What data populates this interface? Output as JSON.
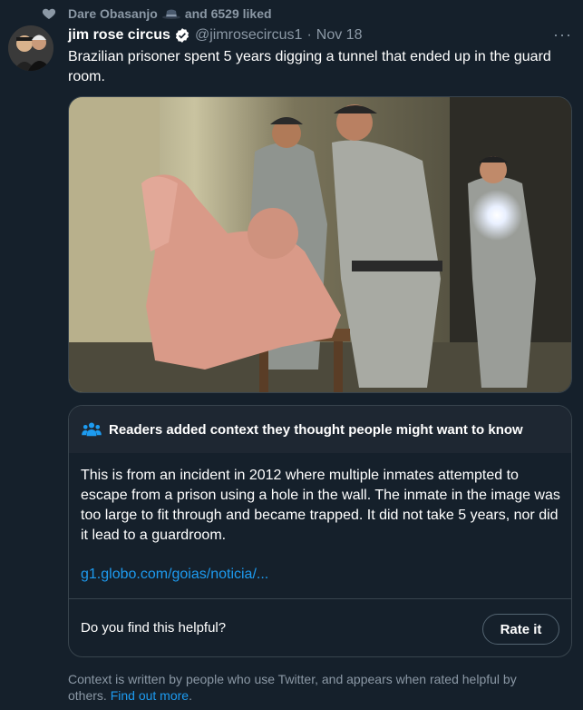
{
  "social_context": {
    "text": "Dare Obasanjo",
    "suffix": "and 6529 liked",
    "icon": "heart-icon"
  },
  "tweet": {
    "display_name": "jim rose circus",
    "handle": "@jimrosecircus1",
    "separator": "·",
    "date": "Nov 18",
    "more": "···",
    "text": "Brazilian prisoner spent 5 years digging a tunnel that ended up in the guard room."
  },
  "birdwatch": {
    "header": "Readers added context they thought people might want to know",
    "body": "This is from an incident in 2012 where multiple inmates attempted to escape from a prison using a hole in the wall. The inmate in the image was too large to fit through and became trapped. It did not take 5 years, nor did it lead to a guardroom.",
    "link": "g1.globo.com/goias/noticia/...",
    "question": "Do you find this helpful?",
    "rate_button": "Rate it"
  },
  "footer": {
    "text": "Context is written by people who use Twitter, and appears when rated helpful by others.",
    "link": "Find out more",
    "end": "."
  },
  "colors": {
    "background": "#15202b",
    "accent": "#1d9bf0",
    "secondary_text": "#8b98a5",
    "border": "#38444d"
  }
}
